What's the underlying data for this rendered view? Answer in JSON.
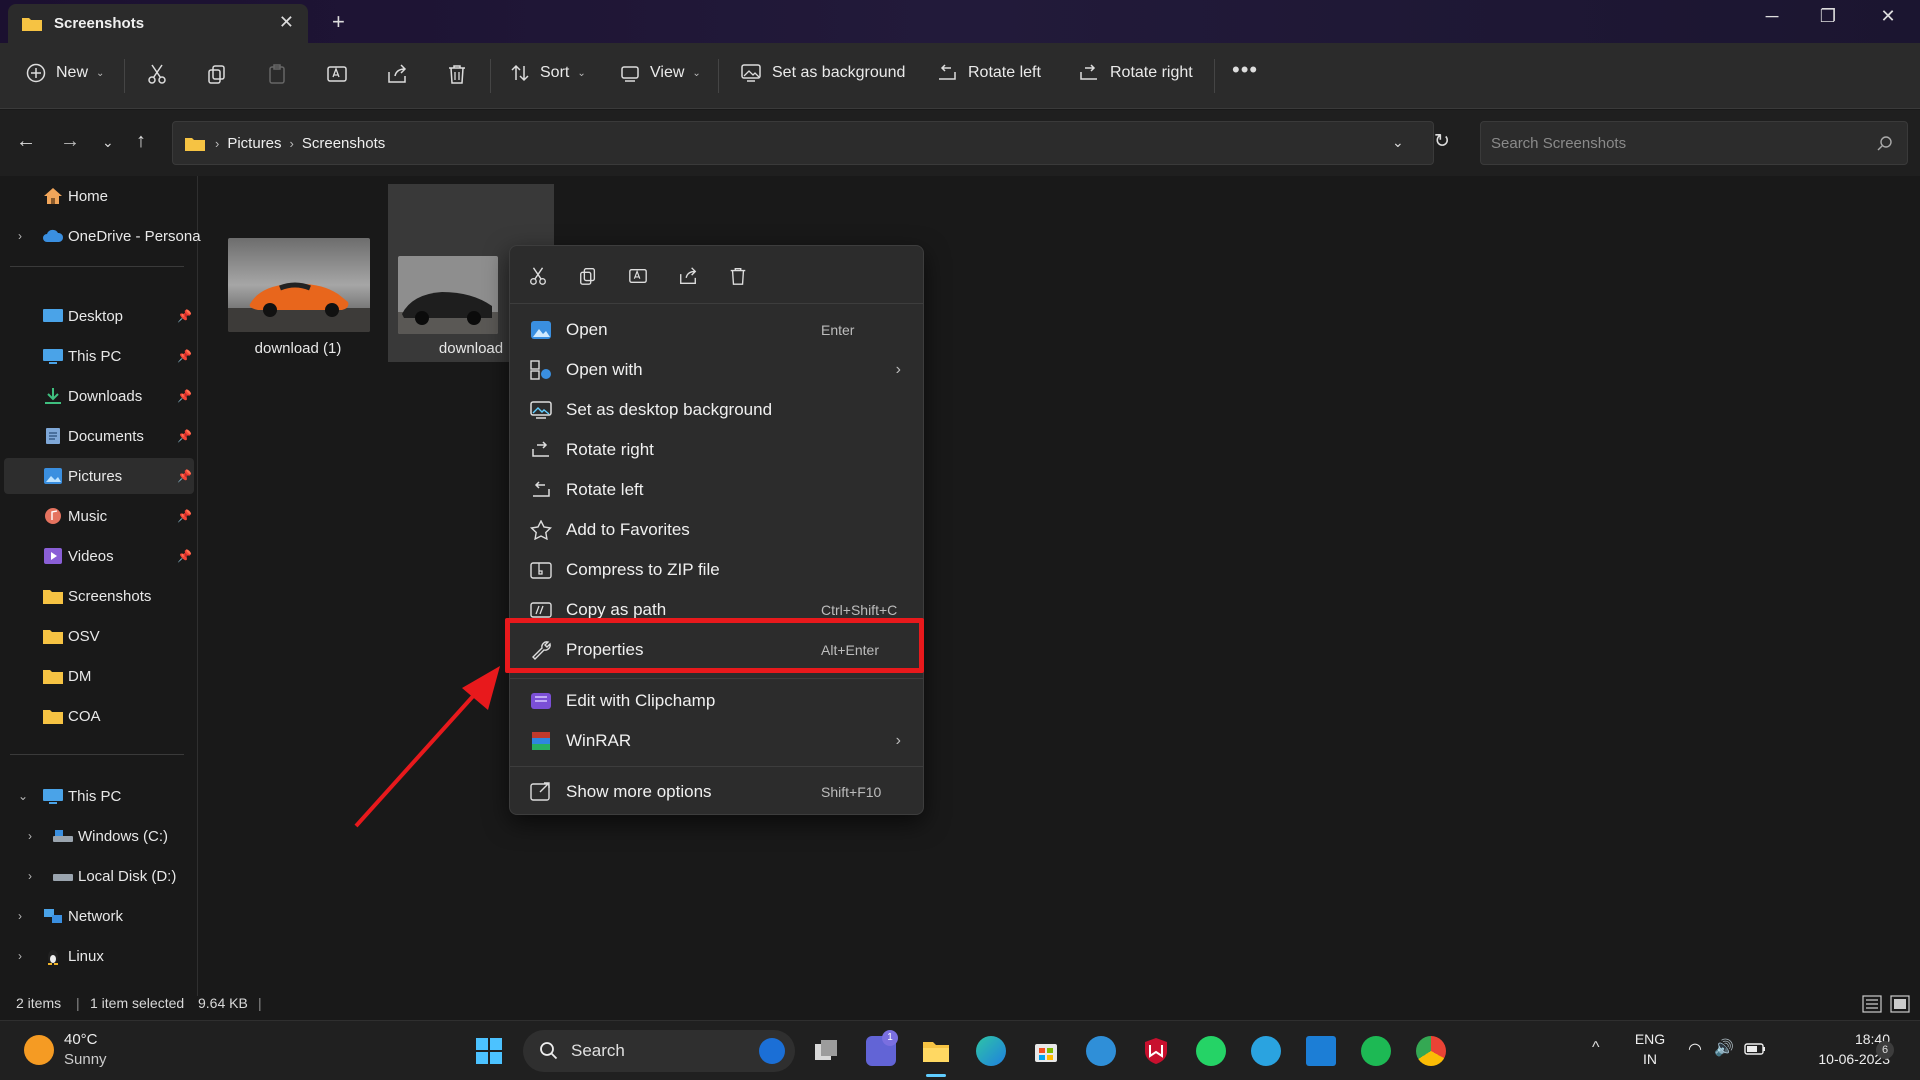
{
  "window": {
    "tab_title": "Screenshots",
    "new_tab_icon": "plus-icon"
  },
  "toolbar": {
    "new_label": "New",
    "sort_label": "Sort",
    "view_label": "View",
    "set_bg_label": "Set as background",
    "rotate_left_label": "Rotate left",
    "rotate_right_label": "Rotate right"
  },
  "address": {
    "crumbs": [
      "Pictures",
      "Screenshots"
    ],
    "search_placeholder": "Search Screenshots"
  },
  "sidebar": {
    "items": [
      {
        "label": "Home"
      },
      {
        "label": "OneDrive - Persona"
      },
      {
        "label": "Desktop"
      },
      {
        "label": "This PC"
      },
      {
        "label": "Downloads"
      },
      {
        "label": "Documents"
      },
      {
        "label": "Pictures"
      },
      {
        "label": "Music"
      },
      {
        "label": "Videos"
      },
      {
        "label": "Screenshots"
      },
      {
        "label": "OSV"
      },
      {
        "label": "DM"
      },
      {
        "label": "COA"
      },
      {
        "label": "This PC"
      },
      {
        "label": "Windows (C:)"
      },
      {
        "label": "Local Disk (D:)"
      },
      {
        "label": "Network"
      },
      {
        "label": "Linux"
      }
    ]
  },
  "files": [
    {
      "name": "download (1)"
    },
    {
      "name": "download"
    }
  ],
  "context_menu": {
    "items": [
      {
        "label": "Open",
        "shortcut": "Enter"
      },
      {
        "label": "Open with",
        "shortcut": ""
      },
      {
        "label": "Set as desktop background",
        "shortcut": ""
      },
      {
        "label": "Rotate right",
        "shortcut": ""
      },
      {
        "label": "Rotate left",
        "shortcut": ""
      },
      {
        "label": "Add to Favorites",
        "shortcut": ""
      },
      {
        "label": "Compress to ZIP file",
        "shortcut": ""
      },
      {
        "label": "Copy as path",
        "shortcut": "Ctrl+Shift+C"
      },
      {
        "label": "Properties",
        "shortcut": "Alt+Enter"
      },
      {
        "label": "Edit with Clipchamp",
        "shortcut": ""
      },
      {
        "label": "WinRAR",
        "shortcut": ""
      },
      {
        "label": "Show more options",
        "shortcut": "Shift+F10"
      }
    ]
  },
  "status": {
    "item_count": "2 items",
    "selection": "1 item selected",
    "size": "9.64 KB"
  },
  "taskbar": {
    "weather_temp": "40°C",
    "weather_desc": "Sunny",
    "search_label": "Search",
    "chat_badge": "1",
    "lang_top": "ENG",
    "lang_bottom": "IN",
    "time": "18:40",
    "date": "10-06-2023",
    "notif_count": "6"
  },
  "colors": {
    "highlight": "#e8191c",
    "accent": "#60cdff"
  }
}
